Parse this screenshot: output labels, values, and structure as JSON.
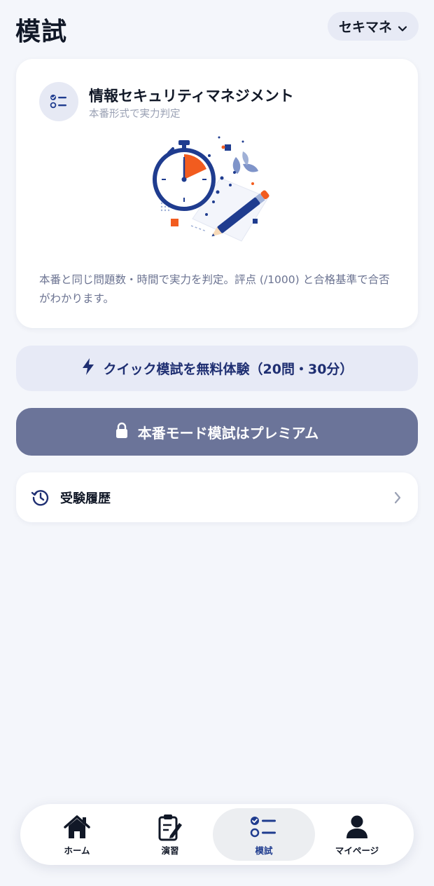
{
  "header": {
    "title": "模試",
    "exam_selector": {
      "value": "セキマネ",
      "icon": "chevron-down-icon"
    }
  },
  "exam_card": {
    "icon": "checklist-icon",
    "title": "情報セキュリティマネジメント",
    "subtitle": "本番形式で実力判定",
    "illustration": "stopwatch-and-pencil-illustration",
    "description": "本番と同じ問題数・時間で実力を判定。評点 (/1000) と合格基準で合否がわかります。"
  },
  "quick_exam_button": {
    "icon": "lightning-icon",
    "label": "クイック模試を無料体験（20問・30分）"
  },
  "premium_button": {
    "icon": "lock-icon",
    "label": "本番モード模試はプレミアム"
  },
  "history": {
    "icon": "history-icon",
    "label": "受験履歴",
    "chevron": "chevron-right-icon"
  },
  "bottom_nav": {
    "items": [
      {
        "label": "ホーム",
        "icon": "home-icon",
        "active": false
      },
      {
        "label": "演習",
        "icon": "clipboard-edit-icon",
        "active": false
      },
      {
        "label": "模試",
        "icon": "checklist-icon",
        "active": true
      },
      {
        "label": "マイページ",
        "icon": "user-icon",
        "active": false
      }
    ]
  },
  "colors": {
    "background": "#f4f6fb",
    "accent": "#1f3c8f",
    "premium": "#6b7499",
    "quick_bg": "#e7eaf6",
    "orange": "#f25c1f"
  }
}
